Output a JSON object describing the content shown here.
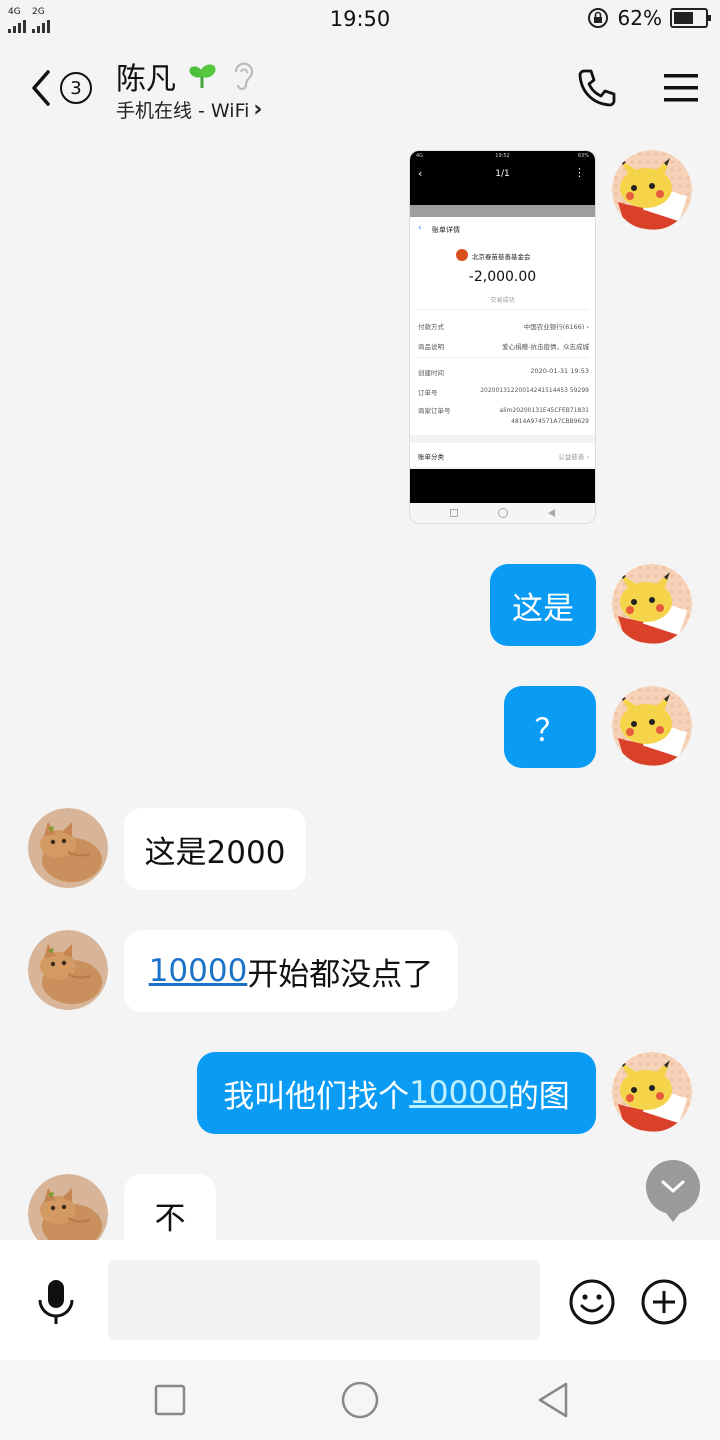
{
  "status_bar": {
    "network_left": "4G",
    "network_right": "2G",
    "time": "19:50",
    "battery_percent": "62%",
    "battery_level": 0.62
  },
  "header": {
    "unread_count": "3",
    "contact_name": "陈凡",
    "status": "手机在线 - WiFi",
    "status_chevron": "›"
  },
  "image_message": {
    "title": "1/1",
    "page_title": "账单详情",
    "merchant": "北京春苗慈善基金会",
    "amount": "-2,000.00",
    "result": "交易成功",
    "rows": [
      {
        "label": "付款方式",
        "value": "中国农业银行(6166) ›"
      },
      {
        "label": "商品说明",
        "value": "爱心捐赠-抗击疫情，众志成城"
      },
      {
        "label": "创建时间",
        "value": "2020-01-31 19:53"
      },
      {
        "label": "订单号",
        "value": "20200131220014241514453 59299"
      },
      {
        "label": "商家订单号",
        "value": "alim20200131E45CFEB71831 4814A974571A7CBB9629"
      }
    ],
    "category_label": "账单分类",
    "category_value": "公益慈善 ›"
  },
  "messages": [
    {
      "side": "out",
      "text": "这是"
    },
    {
      "side": "out",
      "text": "？"
    },
    {
      "side": "in",
      "text": "这是2000"
    },
    {
      "side": "in",
      "link": "10000",
      "text": "开始都没点了"
    },
    {
      "side": "out",
      "prefix": "我叫他们找个",
      "link": "10000",
      "suffix": "的图"
    },
    {
      "side": "in",
      "text": "不"
    }
  ],
  "input": {
    "placeholder": ""
  },
  "icons": {
    "back": "chevron-left-icon",
    "leaf": "leaf-icon",
    "ear": "ear-icon",
    "phone": "phone-icon",
    "menu": "menu-icon",
    "mic": "microphone-icon",
    "emoji": "smiley-icon",
    "plus": "plus-icon",
    "scroll": "chevron-down-icon"
  },
  "colors": {
    "outgoing_bubble": "#0a9bf5",
    "incoming_bubble": "#ffffff",
    "background": "#f4f4f4",
    "link_incoming": "#1a73c9"
  }
}
